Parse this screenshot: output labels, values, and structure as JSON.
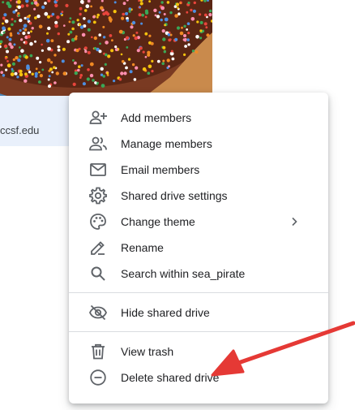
{
  "drive_card": {
    "owner_text": "ccsf.edu"
  },
  "menu": {
    "items": [
      {
        "id": "add-members",
        "label": "Add members",
        "icon": "person-add-icon"
      },
      {
        "id": "manage-members",
        "label": "Manage members",
        "icon": "people-icon"
      },
      {
        "id": "email-members",
        "label": "Email members",
        "icon": "mail-icon"
      },
      {
        "id": "shared-drive-settings",
        "label": "Shared drive settings",
        "icon": "gear-icon"
      },
      {
        "id": "change-theme",
        "label": "Change theme",
        "icon": "palette-icon",
        "has_submenu": true
      },
      {
        "id": "rename",
        "label": "Rename",
        "icon": "pencil-icon"
      },
      {
        "id": "search-within",
        "label": "Search within sea_pirate",
        "icon": "search-icon"
      }
    ],
    "group2": [
      {
        "id": "hide-shared-drive",
        "label": "Hide shared drive",
        "icon": "eye-off-icon"
      }
    ],
    "group3": [
      {
        "id": "view-trash",
        "label": "View trash",
        "icon": "trash-icon"
      },
      {
        "id": "delete-shared-drive",
        "label": "Delete shared drive",
        "icon": "minus-circle-icon"
      }
    ]
  },
  "colors": {
    "icon": "#5f6368",
    "text": "#202124",
    "annotation_arrow": "#e53935",
    "divider": "#dadce0"
  }
}
